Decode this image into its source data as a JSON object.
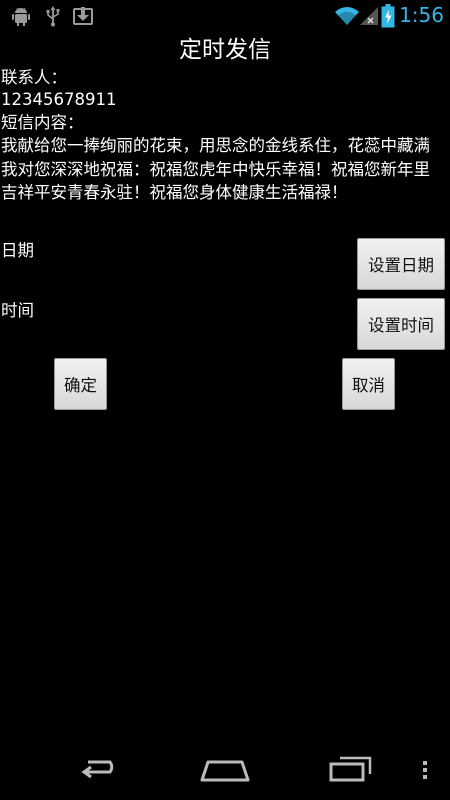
{
  "status_bar": {
    "time": "1:56",
    "accent": "#33b5e5",
    "left_icons": [
      "android-debug-icon",
      "usb-icon",
      "download-icon"
    ],
    "right_icons": [
      "wifi-icon",
      "signal-icon",
      "battery-icon"
    ]
  },
  "page": {
    "title": "定时发信"
  },
  "contact": {
    "label": "联系人：",
    "value": "12345678911"
  },
  "message": {
    "label": "短信内容：",
    "body": "我献给您一捧绚丽的花束，用思念的金线系住，花蕊中藏满我对您深深地祝福：祝福您虎年中快乐幸福！祝福您新年里吉祥平安青春永驻！祝福您身体健康生活福禄！"
  },
  "date_row": {
    "label": "日期",
    "button": "设置日期"
  },
  "time_row": {
    "label": "时间",
    "button": "设置时间"
  },
  "actions": {
    "confirm": "确定",
    "cancel": "取消"
  },
  "nav_bar": {
    "icons": [
      "back-icon",
      "home-icon",
      "recent-apps-icon",
      "menu-icon"
    ]
  }
}
